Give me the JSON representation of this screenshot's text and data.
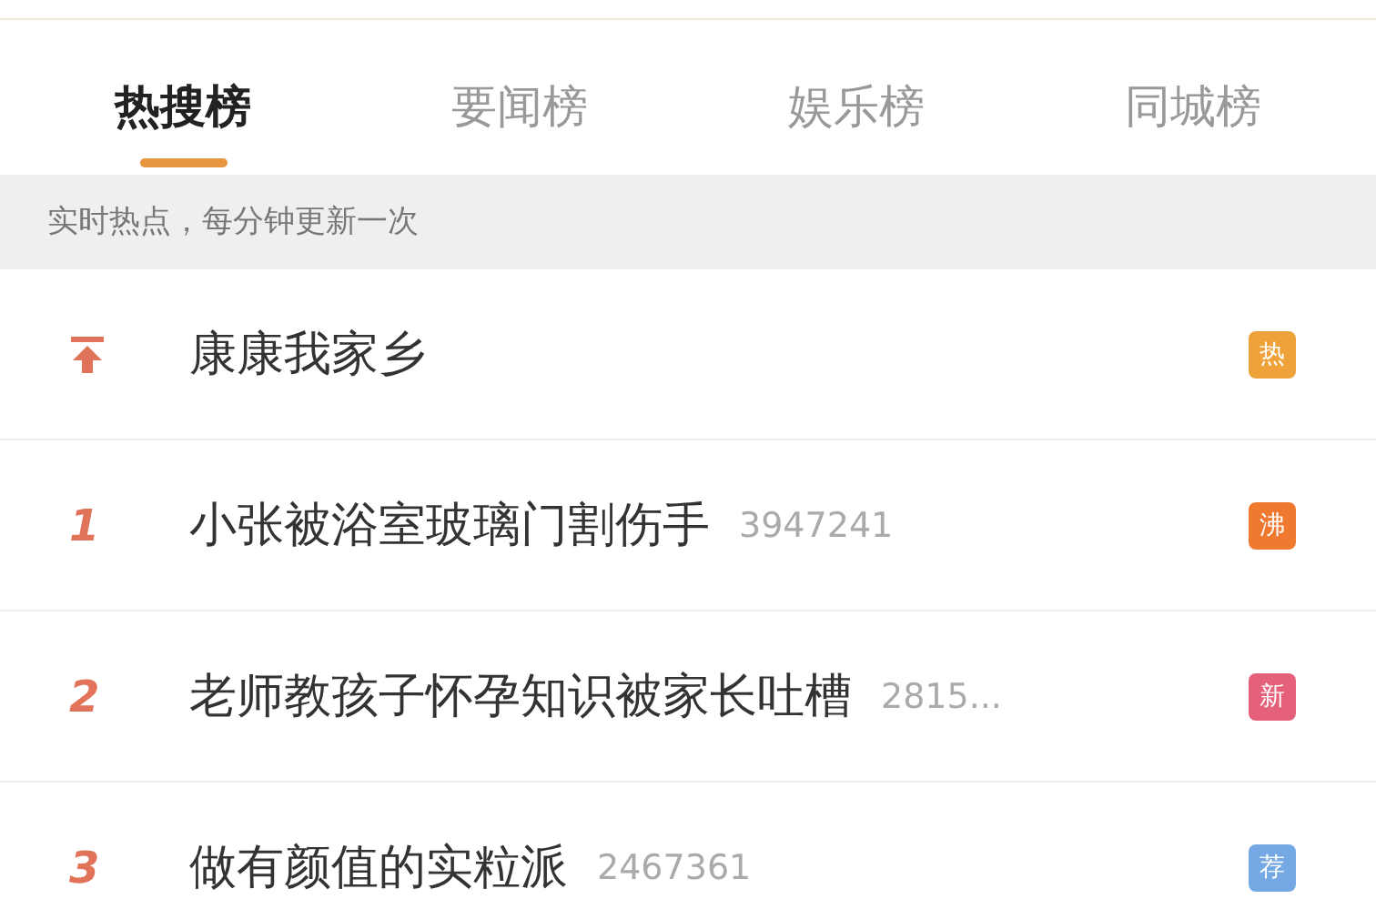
{
  "tabs": [
    {
      "label": "热搜榜",
      "selected": true
    },
    {
      "label": "要闻榜",
      "selected": false
    },
    {
      "label": "娱乐榜",
      "selected": false
    },
    {
      "label": "同城榜",
      "selected": false
    }
  ],
  "notice": "实时热点，每分钟更新一次",
  "items": [
    {
      "kind": "pinned",
      "title": "康康我家乡",
      "badge": "热",
      "color": "#f0a23a"
    },
    {
      "kind": "ranked",
      "rank": "1",
      "title": "小张被浴室玻璃门割伤手",
      "count": "3947241",
      "badge": "沸",
      "color": "#ef7a2f"
    },
    {
      "kind": "ranked",
      "rank": "2",
      "title": "老师教孩子怀孕知识被家长吐槽",
      "count": "2815...",
      "badge": "新",
      "color": "#e5617a"
    },
    {
      "kind": "ranked",
      "rank": "3",
      "title": "做有颜值的实粒派",
      "count": "2467361",
      "badge": "荐",
      "color": "#74a9e6"
    }
  ]
}
